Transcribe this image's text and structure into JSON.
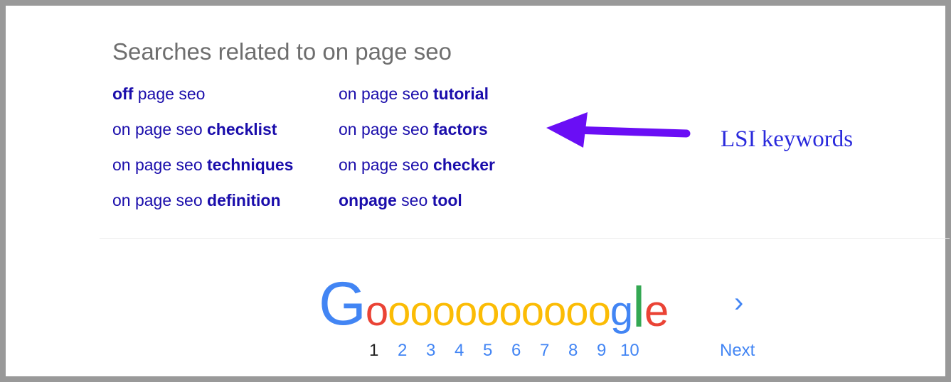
{
  "related": {
    "heading": "Searches related to on page seo",
    "links": [
      {
        "pre": "",
        "bold": "off",
        "post": " page seo"
      },
      {
        "pre": "on page seo ",
        "bold": "tutorial",
        "post": ""
      },
      {
        "pre": "on page seo ",
        "bold": "checklist",
        "post": ""
      },
      {
        "pre": "on page seo ",
        "bold": "factors",
        "post": ""
      },
      {
        "pre": "on page seo ",
        "bold": "techniques",
        "post": ""
      },
      {
        "pre": "on page seo ",
        "bold": "checker",
        "post": ""
      },
      {
        "pre": "on page seo ",
        "bold": "definition",
        "post": ""
      },
      {
        "pre": "",
        "bold": "onpage",
        "post": " seo ",
        "bold2": "tool"
      }
    ]
  },
  "annotation": {
    "label": "LSI keywords",
    "arrow_color": "#6a0ef5",
    "text_color": "#2a2adc"
  },
  "logo": {
    "letters": [
      "G",
      "o",
      "o",
      "o",
      "o",
      "o",
      "o",
      "o",
      "o",
      "o",
      "o",
      "o",
      "g",
      "l",
      "e"
    ],
    "colors": {
      "G": "#4285f4",
      "first_o": "#ea4335",
      "other_o": "#fbbc05",
      "g": "#4285f4",
      "l": "#34a853",
      "e": "#ea4335"
    }
  },
  "pagination": {
    "chevron": "›",
    "pages": [
      "1",
      "2",
      "3",
      "4",
      "5",
      "6",
      "7",
      "8",
      "9",
      "10"
    ],
    "current": "1",
    "next_label": "Next"
  },
  "colors": {
    "link": "#1a0dab",
    "heading": "#6e6e6e",
    "page_link": "#4285f4",
    "frame_border": "#999999"
  }
}
